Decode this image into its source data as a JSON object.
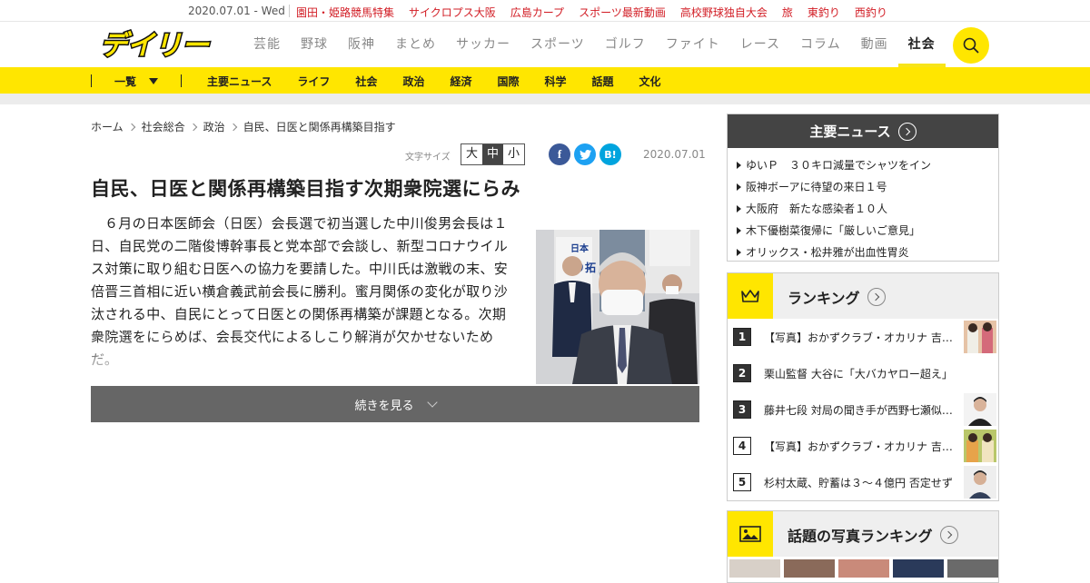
{
  "topbar": {
    "date": "2020.07.01 - Wed",
    "links": [
      "園田・姫路競馬特集",
      "サイクロプス大阪",
      "広島カープ",
      "スポーツ最新動画",
      "高校野球独自大会",
      "旅",
      "東釣り",
      "西釣り"
    ]
  },
  "header": {
    "logo_text": "デイリー",
    "nav": [
      {
        "label": "芸能"
      },
      {
        "label": "野球"
      },
      {
        "label": "阪神"
      },
      {
        "label": "まとめ"
      },
      {
        "label": "サッカー"
      },
      {
        "label": "スポーツ"
      },
      {
        "label": "ゴルフ"
      },
      {
        "label": "ファイト"
      },
      {
        "label": "レース"
      },
      {
        "label": "コラム"
      },
      {
        "label": "動画"
      },
      {
        "label": "社会"
      }
    ],
    "active_nav": "社会"
  },
  "subnav": {
    "list_label": "一覧",
    "items": [
      "主要ニュース",
      "ライフ",
      "社会",
      "政治",
      "経済",
      "国際",
      "科学",
      "話題",
      "文化"
    ]
  },
  "breadcrumb": [
    "ホーム",
    "社会総合",
    "政治",
    "自民、日医と関係再構築目指す"
  ],
  "tools": {
    "font_size_label": "文字サイズ",
    "font_sizes": [
      "大",
      "中",
      "小"
    ],
    "font_size_selected": "中",
    "share": {
      "facebook": "f",
      "twitter": "t",
      "hatena": "B!"
    },
    "date": "2020.07.01"
  },
  "article": {
    "title": "自民、日医と関係再構築目指す次期衆院選にらみ",
    "body": "６月の日本医師会（日医）会長選で初当選した中川俊男会長は１日、自民党の二階俊博幹事長と党本部で会談し、新型コロナウイルス対策に取り組む日医への協力を要請した。中川氏は激戦の末、安倍晋三首相に近い横倉義武前会長に勝利。蜜月関係の変化が取り沙汰される中、自民にとって日医との関係再構築が課題となる。次期衆院選をにらめば、会長交代によるしこり解消が欠かせないためだ。",
    "photo_sign": "日本\n切り拓",
    "more_label": "続きを見る"
  },
  "main_news": {
    "title": "主要ニュース",
    "items": [
      "ゆいＰ　３０キロ減量でシャツをイン",
      "阪神ボーアに待望の来日１号",
      "大阪府　新たな感染者１０人",
      "木下優樹菜復帰に「厳しいご意見」",
      "オリックス・松井雅が出血性胃炎"
    ]
  },
  "ranking": {
    "title": "ランキング",
    "items": [
      {
        "rank": "1",
        "text": "【写真】おかずクラブ・オカリナ 吉…"
      },
      {
        "rank": "2",
        "text": "栗山監督 大谷に「大バカヤロー超え」"
      },
      {
        "rank": "3",
        "text": "藤井七段 対局の聞き手が西野七瀬似…"
      },
      {
        "rank": "4",
        "text": "【写真】おかずクラブ・オカリナ 吉…"
      },
      {
        "rank": "5",
        "text": "杉村太蔵、貯蓄は３～４億円 否定せず"
      }
    ]
  },
  "photo_ranking": {
    "title": "話題の写真ランキング"
  },
  "colors": {
    "brand_yellow": "#ffe600",
    "link_red": "#d21d25",
    "dark": "#444444"
  }
}
